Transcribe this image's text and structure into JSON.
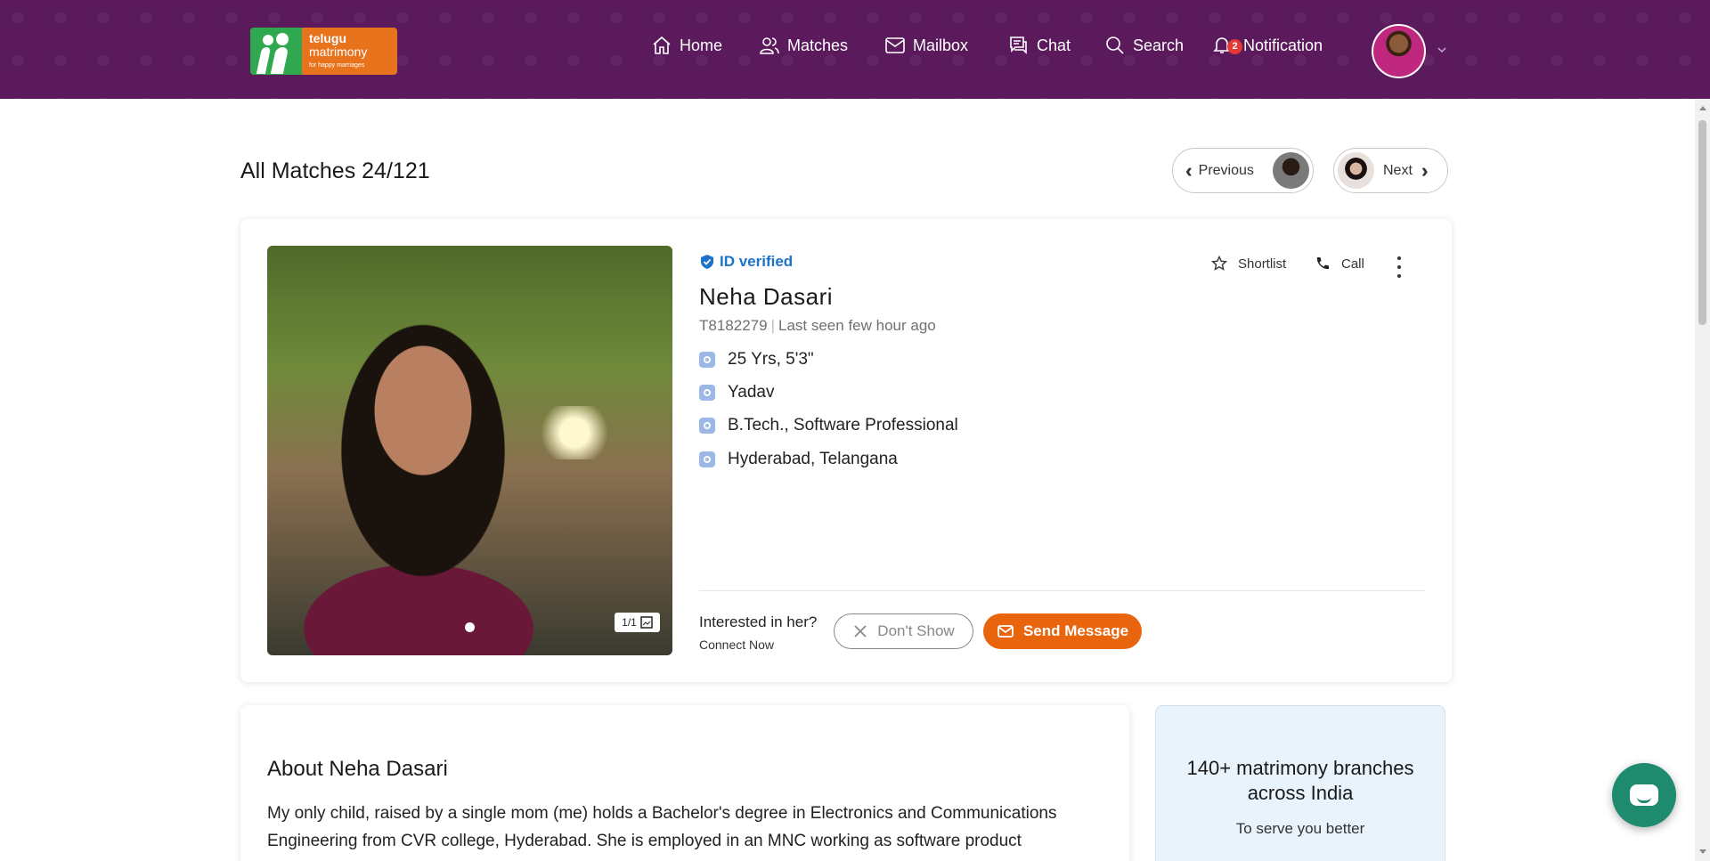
{
  "logo": {
    "line1": "telugu",
    "line2": "matrimony",
    "tagline": "for happy marriages"
  },
  "nav": {
    "home": "Home",
    "matches": "Matches",
    "mailbox": "Mailbox",
    "chat": "Chat",
    "search": "Search",
    "notification": "Notification",
    "notification_count": "2"
  },
  "main": {
    "title": "All Matches 24/121",
    "previous": "Previous",
    "next": "Next"
  },
  "profile": {
    "verified": "ID verified",
    "name": "Neha Dasari",
    "id": "T8182279",
    "last_seen": "Last seen few hour ago",
    "age_height": "25 Yrs, 5'3\"",
    "caste": "Yadav",
    "education_job": "B.Tech., Software Professional",
    "location": "Hyderabad, Telangana",
    "photo_counter": "1/1",
    "shortlist": "Shortlist",
    "call": "Call",
    "interest_question": "Interested in her?",
    "interest_sub": "Connect Now",
    "dont_show": "Don't Show",
    "send_message": "Send Message"
  },
  "about": {
    "title": "About Neha Dasari",
    "text": "My only child, raised by a single mom (me) holds a Bachelor's degree in Electronics and Communications Engineering from CVR college, Hyderabad. She is employed in an MNC working as software product manager. We belong to a middle class joint family with"
  },
  "branches": {
    "title": "140+ matrimony branches across India",
    "subtitle": "To serve you better"
  },
  "colors": {
    "header": "#5a1a5c",
    "accent": "#e8650e",
    "verified": "#1c73c9",
    "chat_fab": "#1e8a6e"
  }
}
